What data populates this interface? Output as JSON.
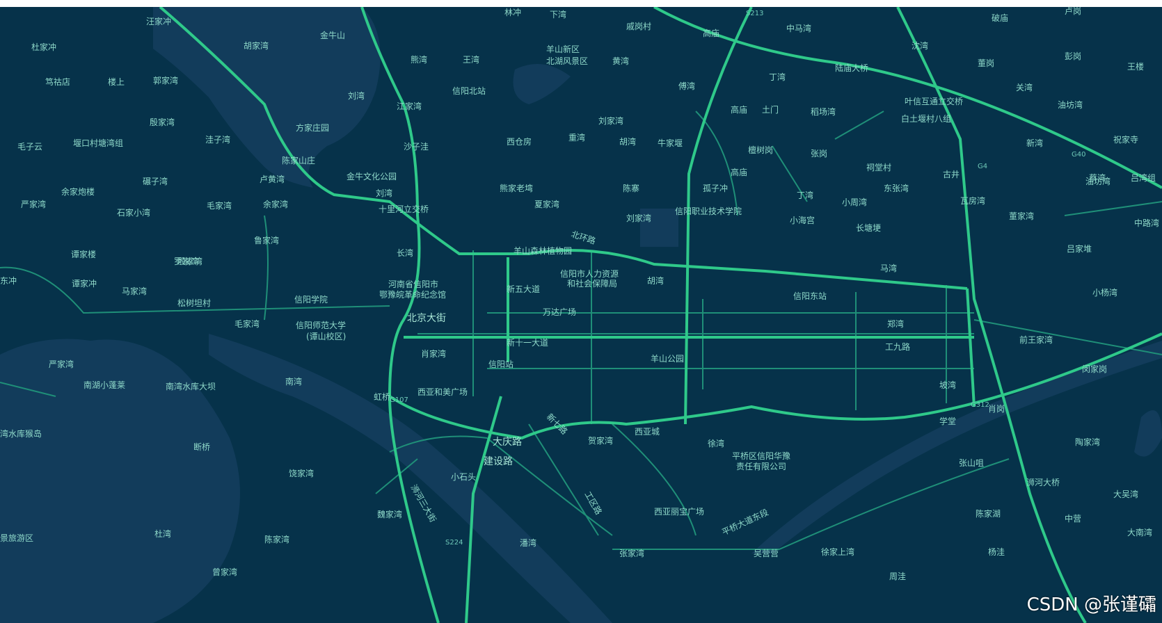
{
  "map": {
    "water_color": "#123c5b",
    "land_color": "#06324a",
    "highway_color": "#2fc98a",
    "road_color": "#1f8f78",
    "label_color": "#8fd9c9",
    "watermark": "CSDN @张谨礵",
    "places": [
      "汪家冲",
      "胡家湾",
      "金牛山",
      "林冲",
      "下湾",
      "戚岗村",
      "高庙",
      "中马湾",
      "沈湾",
      "破庙",
      "卢岗",
      "杜家冲",
      "熊湾",
      "王湾",
      "羊山新区",
      "北湖风景区",
      "黄湾",
      "丁湾",
      "陆庙大桥",
      "董岗",
      "彭岗",
      "王楼",
      "笃祜店",
      "楼上",
      "郭家湾",
      "刘湾",
      "信阳北站",
      "傅湾",
      "关湾",
      "江家湾",
      "高庙",
      "土门",
      "稻场湾",
      "叶信互通立交桥",
      "油坊湾",
      "油坊湾",
      "殷家湾",
      "方家庄园",
      "刘家湾",
      "白土堰村八组",
      "毛子云",
      "堰口村塘湾组",
      "洼子湾",
      "沙子洼",
      "西仓房",
      "重湾",
      "胡湾",
      "牛家堰",
      "檀树岗",
      "张岗",
      "新湾",
      "祝家寺",
      "陈家山庄",
      "碾子湾",
      "卢黄湾",
      "金牛文化公园",
      "祠堂村",
      "古井",
      "蔡湾",
      "吕湾组",
      "余家炮楼",
      "熊家老塆",
      "陈寨",
      "孤子冲",
      "东张湾",
      "严家湾",
      "毛家湾",
      "余家湾",
      "夏家湾",
      "小周湾",
      "瓦房湾",
      "石家小湾",
      "十里河立交桥",
      "信阳职业技术学院",
      "小海宫",
      "董家湾",
      "中路湾",
      "谭家楼",
      "殷家湾",
      "鲁家湾",
      "长塘埂",
      "长湾",
      "羊山森林植物园",
      "吕家堆",
      "罗家湾",
      "马湾",
      "东冲",
      "谭家冲",
      "马家湾",
      "河南省信阳市",
      "信阳市人力资源",
      "和社会保障局",
      "丁湾",
      "胡湾",
      "小杨湾",
      "松树坦村",
      "鄂豫皖革命纪念馆",
      "信阳学院",
      "新五大道",
      "信阳东站",
      "北京大街",
      "万达广场",
      "信阳师范大学",
      "(谭山校区)",
      "郑湾",
      "前王家湾",
      "新十一大道",
      "工九路",
      "肖家湾",
      "严家湾",
      "羊山公园",
      "刘家湾",
      "信阳站",
      "闵家岗",
      "南湖小蓬莱",
      "南湾水库大坝",
      "南湾",
      "西亚和美广场",
      "虹桥",
      "坡湾",
      "肖岗",
      "学堂",
      "湾水库猴岛",
      "西亚城",
      "贺家湾",
      "徐湾",
      "陶家湾",
      "大庆路",
      "断桥",
      "平桥区信阳华豫",
      "责任有限公司",
      "刘湾",
      "张山咀",
      "建设路",
      "饶家湾",
      "小石头",
      "浉河大桥",
      "大吴湾",
      "西亚丽宝广场",
      "陈家湖",
      "中营",
      "景旅游区",
      "杜湾",
      "高庙",
      "魏家湾",
      "潘湾",
      "大南湾",
      "陈家湾",
      "张家湾",
      "吴营营",
      "徐家上湾",
      "杨洼",
      "毛家湾",
      "曾家湾",
      "周洼"
    ],
    "road_names": [
      "北环路",
      "羊山新区",
      "平桥大道东段",
      "工区路",
      "浉河三大街",
      "新七路"
    ],
    "highway_shields": [
      "G4",
      "G40",
      "G107",
      "G312",
      "S224",
      "S213"
    ]
  }
}
